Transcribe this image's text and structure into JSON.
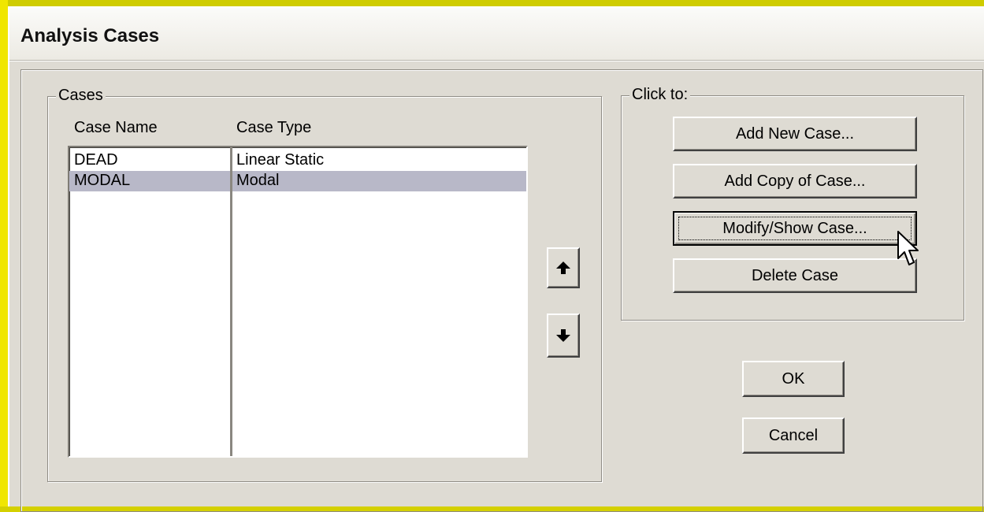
{
  "window": {
    "title": "Analysis Cases"
  },
  "cases_group": {
    "label": "Cases",
    "columns": [
      "Case Name",
      "Case Type"
    ],
    "rows": [
      {
        "name": "DEAD",
        "type": "Linear Static",
        "selected": false
      },
      {
        "name": "MODAL",
        "type": "Modal",
        "selected": true
      }
    ]
  },
  "reorder": {
    "up_icon": "arrow-up-icon",
    "down_icon": "arrow-down-icon"
  },
  "actions_group": {
    "label": "Click to:",
    "add_new": "Add New Case...",
    "add_copy": "Add Copy of Case...",
    "modify_show": "Modify/Show Case...",
    "delete": "Delete Case"
  },
  "dialog_buttons": {
    "ok": "OK",
    "cancel": "Cancel"
  },
  "colors": {
    "selection": "#b8b8c8",
    "dialog_bg": "#dedbd3",
    "frame_yellow": "#d4d000"
  }
}
